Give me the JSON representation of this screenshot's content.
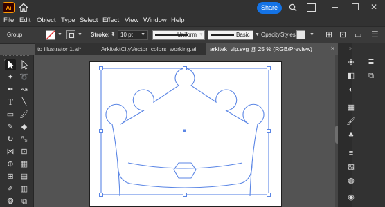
{
  "titlebar": {
    "app_logo": "Ai",
    "share_label": "Share",
    "icons": [
      "home-icon",
      "search-icon",
      "layout-icon",
      "minimize-icon",
      "maximize-icon",
      "close-icon"
    ]
  },
  "menu": [
    "File",
    "Edit",
    "Object",
    "Type",
    "Select",
    "Effect",
    "View",
    "Window",
    "Help"
  ],
  "controlbar": {
    "selection_label": "Group",
    "stroke_label": "Stroke:",
    "stroke_value": "10 pt",
    "profile_label": "Uniform",
    "brush_label": "Basic",
    "opacity_label": "Opacity",
    "styles_label": "Styles:"
  },
  "tabs": [
    {
      "label": "to illustrator 1.ai*",
      "active": false
    },
    {
      "label": "ArkitektCityVector_colors_working.ai",
      "active": false
    },
    {
      "label": "arkitek_vip.svg @ 25 % (RGB/Preview)",
      "active": true
    }
  ],
  "colors": {
    "accent": "#1473e6",
    "selection": "#5b86e5",
    "canvas_bg": "#535353",
    "ui_bg": "#323232"
  }
}
